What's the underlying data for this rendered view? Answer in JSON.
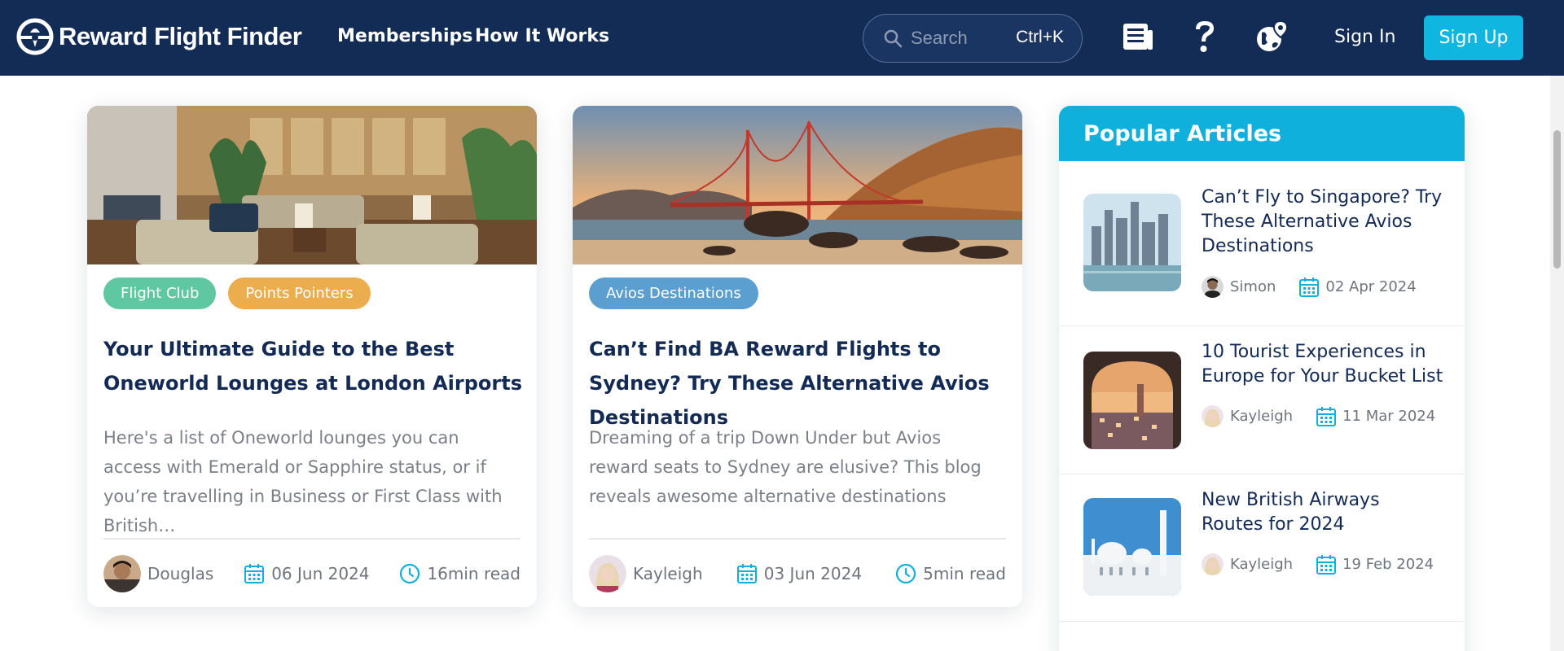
{
  "header": {
    "brand": "Reward Flight Finder",
    "nav": [
      "Memberships",
      "How It Works"
    ],
    "search_placeholder": "Search",
    "search_shortcut": "Ctrl+K",
    "sign_in": "Sign In",
    "sign_up": "Sign Up",
    "icons": [
      "news-icon",
      "help-icon",
      "globe-pin-icon"
    ]
  },
  "articles": [
    {
      "image": "lounge-photo",
      "tags": [
        {
          "label": "Flight Club",
          "color": "#5fc8a3"
        },
        {
          "label": "Points Pointers",
          "color": "#ebad4e"
        }
      ],
      "title": "Your Ultimate Guide to the Best Oneworld Lounges at London Airports",
      "excerpt": "Here's a list of Oneworld lounges you can access with Emerald or Sapphire status, or if you’re travelling in Business or First Class with British…",
      "author": "Douglas",
      "date": "06 Jun 2024",
      "read_time": "16min read"
    },
    {
      "image": "golden-gate-photo",
      "tags": [
        {
          "label": "Avios Destinations",
          "color": "#5a9fcf"
        }
      ],
      "title": "Can’t Find BA Reward Flights to Sydney? Try These Alternative Avios Destinations",
      "excerpt": "Dreaming of a trip Down Under but Avios reward seats to Sydney are elusive? This blog reveals awesome alternative destinations",
      "author": "Kayleigh",
      "date": "03 Jun 2024",
      "read_time": "5min read"
    }
  ],
  "sidebar": {
    "title": "Popular Articles",
    "items": [
      {
        "image": "singapore-photo",
        "title": "Can’t Fly to Singapore? Try These Alternative Avios Destinations",
        "author": "Simon",
        "date": "02 Apr 2024"
      },
      {
        "image": "europe-town-photo",
        "title": "10 Tourist Experiences in Europe for Your Bucket List",
        "author": "Kayleigh",
        "date": "11 Mar 2024"
      },
      {
        "image": "mosque-photo",
        "title": "New British Airways Routes for 2024",
        "author": "Kayleigh",
        "date": "19 Feb 2024"
      }
    ]
  },
  "colors": {
    "header_bg": "#122c56",
    "accent": "#0fb6df",
    "title_text": "#132a55"
  }
}
